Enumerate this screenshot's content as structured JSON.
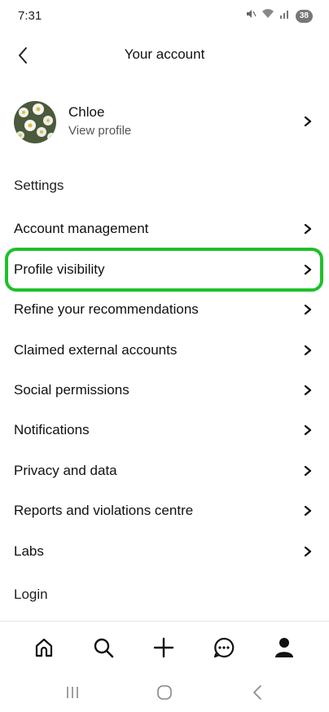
{
  "status_bar": {
    "time": "7:31",
    "battery": "38",
    "icons": [
      "mute-icon",
      "wifi-icon",
      "signal-icon",
      "battery-icon"
    ]
  },
  "header": {
    "title": "Your account",
    "back_icon": "chevron-left-icon"
  },
  "profile": {
    "name": "Chloe",
    "subtitle": "View profile"
  },
  "settings_heading": "Settings",
  "menu": {
    "items": [
      {
        "label": "Account management"
      },
      {
        "label": "Profile visibility"
      },
      {
        "label": "Refine your recommendations"
      },
      {
        "label": "Claimed external accounts"
      },
      {
        "label": "Social permissions"
      },
      {
        "label": "Notifications"
      },
      {
        "label": "Privacy and data"
      },
      {
        "label": "Reports and violations centre"
      },
      {
        "label": "Labs"
      }
    ]
  },
  "login_heading": "Login",
  "colors": {
    "highlight": "#1fbf2a",
    "text": "#111111",
    "subtext": "#555555"
  },
  "tab_bar": {
    "tabs": [
      "home-icon",
      "search-icon",
      "plus-icon",
      "messages-icon",
      "profile-icon"
    ],
    "active": "profile-icon"
  },
  "system_nav": [
    "recent-apps-icon",
    "home-circle-icon",
    "back-icon"
  ]
}
